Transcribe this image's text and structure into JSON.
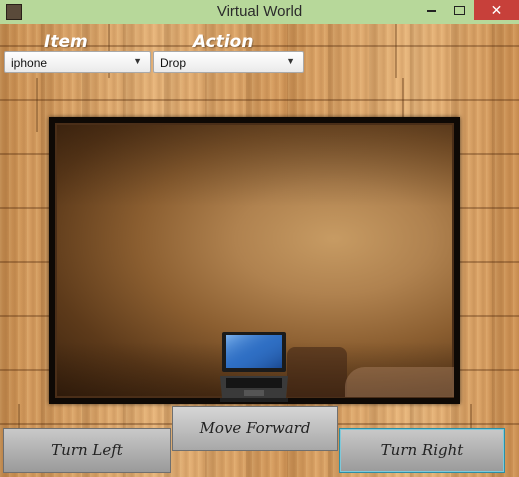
{
  "window": {
    "title": "Virtual World",
    "titlebar_color": "#b7d89a",
    "close_symbol": "✕"
  },
  "controls": {
    "item_label": "Item",
    "action_label": "Action",
    "item_selected": "iphone",
    "action_selected": "Drop"
  },
  "scene": {
    "displayed_object": "laptop-icon"
  },
  "buttons": {
    "turn_left": "Turn Left",
    "move_forward": "Move Forward",
    "turn_right": "Turn Right"
  }
}
